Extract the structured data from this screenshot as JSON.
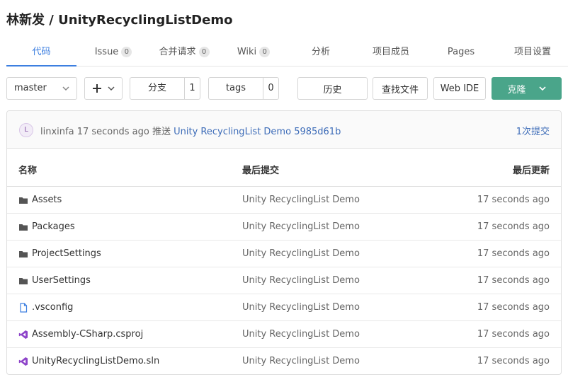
{
  "header": {
    "title": "林新发 / UnityRecyclingListDemo"
  },
  "tabs": [
    {
      "label": "代码",
      "active": true
    },
    {
      "label": "Issue",
      "count": "0"
    },
    {
      "label": "合并请求",
      "count": "0"
    },
    {
      "label": "Wiki",
      "count": "0"
    },
    {
      "label": "分析"
    },
    {
      "label": "项目成员"
    },
    {
      "label": "Pages"
    },
    {
      "label": "项目设置"
    }
  ],
  "toolbar": {
    "branch": "master",
    "add_icon": "plus-icon",
    "branches_label": "分支",
    "branches_count": "1",
    "tags_label": "tags",
    "tags_count": "0",
    "history_label": "历史",
    "find_file_label": "查找文件",
    "web_ide_label": "Web IDE",
    "clone_label": "克隆"
  },
  "commit": {
    "avatar_letter": "L",
    "author": "linxinfa",
    "time": "17 seconds ago",
    "action": "推送",
    "message": "Unity RecyclingList Demo",
    "sha": "5985d61b",
    "count_label": "1次提交"
  },
  "table": {
    "headers": {
      "name": "名称",
      "last_commit": "最后提交",
      "last_update": "最后更新"
    },
    "rows": [
      {
        "icon": "folder-icon",
        "name": "Assets",
        "commit": "Unity RecyclingList Demo",
        "time": "17 seconds ago"
      },
      {
        "icon": "folder-icon",
        "name": "Packages",
        "commit": "Unity RecyclingList Demo",
        "time": "17 seconds ago"
      },
      {
        "icon": "folder-icon",
        "name": "ProjectSettings",
        "commit": "Unity RecyclingList Demo",
        "time": "17 seconds ago"
      },
      {
        "icon": "folder-icon",
        "name": "UserSettings",
        "commit": "Unity RecyclingList Demo",
        "time": "17 seconds ago"
      },
      {
        "icon": "file-icon",
        "name": ".vsconfig",
        "commit": "Unity RecyclingList Demo",
        "time": "17 seconds ago"
      },
      {
        "icon": "visual-studio-icon",
        "name": "Assembly-CSharp.csproj",
        "commit": "Unity RecyclingList Demo",
        "time": "17 seconds ago"
      },
      {
        "icon": "visual-studio-icon",
        "name": "UnityRecyclingListDemo.sln",
        "commit": "Unity RecyclingList Demo",
        "time": "17 seconds ago"
      }
    ]
  },
  "colors": {
    "accent": "#3d7fe0",
    "clone_button": "#4aa58a",
    "link": "#3d6cb8",
    "vs_icon": "#8e44c9"
  }
}
